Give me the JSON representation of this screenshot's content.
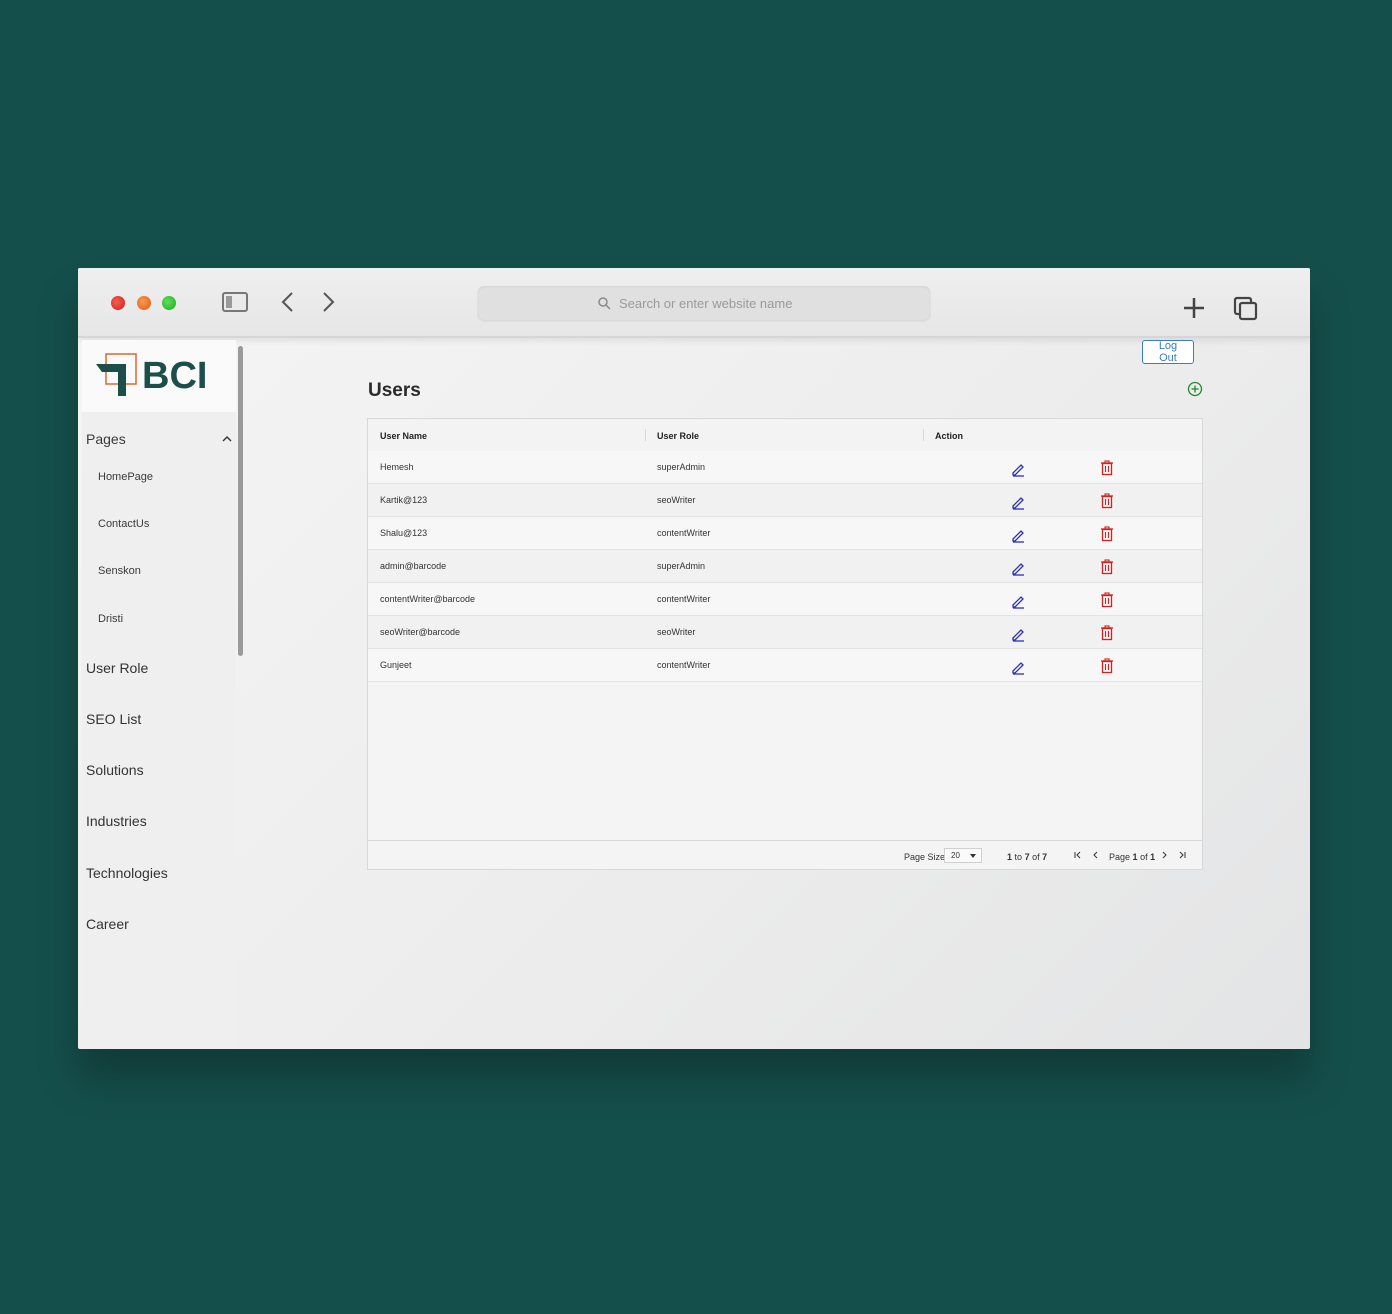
{
  "browser": {
    "search_placeholder": "Search or enter website name"
  },
  "brand": {
    "logo_text": "BCI",
    "primary_color": "#1c4f4a",
    "accent_color": "#e0703a"
  },
  "sidebar": {
    "group_label": "Pages",
    "sub_items": [
      "HomePage",
      "ContactUs",
      "Senskon",
      "Dristi"
    ],
    "items": [
      "User Role",
      "SEO List",
      "Solutions",
      "Industries",
      "Technologies",
      "Career"
    ]
  },
  "header": {
    "logout_label": "Log Out"
  },
  "main": {
    "title": "Users",
    "columns": [
      "User Name",
      "User Role",
      "Action"
    ],
    "rows": [
      {
        "name": "Hemesh",
        "role": "superAdmin"
      },
      {
        "name": "Kartik@123",
        "role": "seoWriter"
      },
      {
        "name": "Shalu@123",
        "role": "contentWriter"
      },
      {
        "name": "admin@barcode",
        "role": "superAdmin"
      },
      {
        "name": "contentWriter@barcode",
        "role": "contentWriter"
      },
      {
        "name": "seoWriter@barcode",
        "role": "seoWriter"
      },
      {
        "name": "Gunjeet",
        "role": "contentWriter"
      }
    ],
    "footer": {
      "page_size_label": "Page Size:",
      "page_size_value": "20",
      "range_from": "1",
      "range_to_label": "to",
      "range_to": "7",
      "range_of_label": "of",
      "range_total": "7",
      "page_label": "Page",
      "page_current": "1",
      "page_of_label": "of",
      "page_total": "1"
    }
  },
  "icons": {
    "edit": "pencil-icon",
    "delete": "trash-icon",
    "add": "plus-circle-icon",
    "edit_color": "#2b2fb5",
    "delete_color": "#d42020",
    "add_color": "#1f8a2e"
  }
}
